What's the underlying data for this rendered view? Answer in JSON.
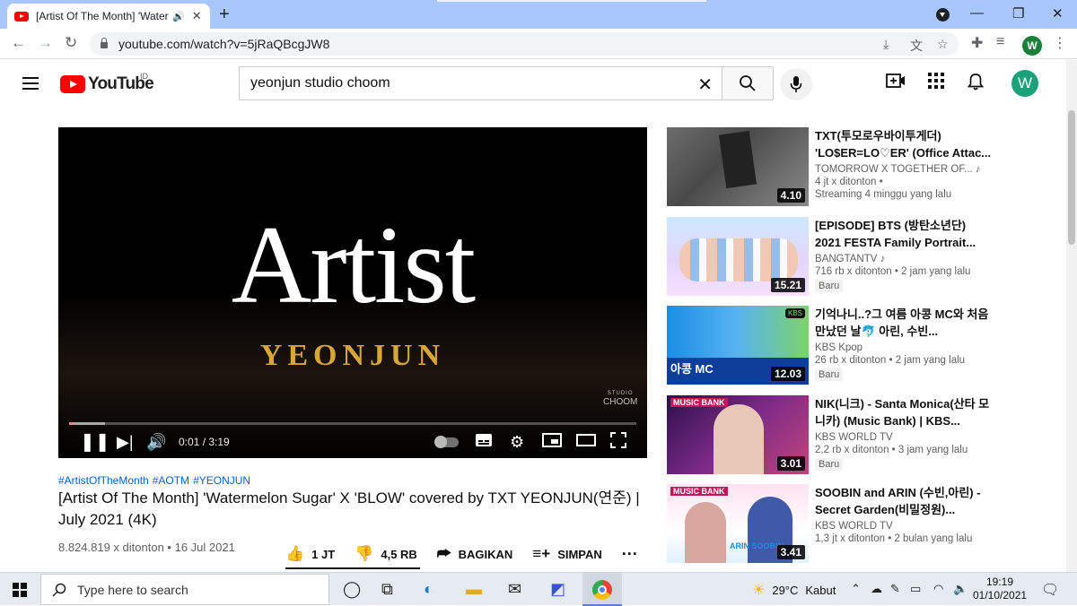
{
  "browser": {
    "tab_title": "[Artist Of The Month] 'Watermelon Sugar' X 'BLOW'",
    "tab_audio_icon": "speaker-icon",
    "url": "youtube.com/watch?v=5jRaQBcgJW8",
    "profile_initial": "W"
  },
  "masthead": {
    "logo_text": "YouTube",
    "country_code": "ID",
    "search_value": "yeonjun studio choom",
    "avatar_initial": "W"
  },
  "player": {
    "title_art": "Artist",
    "subtitle_art": "YEONJUN",
    "studio_mark_top": "STUDIO",
    "studio_mark": "CHOOM",
    "time_display": "0:01 / 3:19",
    "played_fraction": 0.005
  },
  "video": {
    "hashtags": [
      "#ArtistOfTheMonth",
      "#AOTM",
      "#YEONJUN"
    ],
    "title": "[Artist Of The Month] 'Watermelon Sugar' X 'BLOW' covered by TXT YEONJUN(연준) | July 2021 (4K)",
    "meta": "8.824.819 x ditonton • 16 Jul 2021",
    "like_label": "1 JT",
    "dislike_label": "4,5 RB",
    "share_label": "BAGIKAN",
    "save_label": "SIMPAN"
  },
  "recommendations": [
    {
      "title": "TXT(투모로우바이투게더) 'LO$ER=LO♡ER' (Office Attac...",
      "channel": "TOMORROW X TOGETHER OF...",
      "channel_badge": "♪",
      "stats_line1": "4 jt x ditonton •",
      "stats_line2": "Streaming 4 minggu yang lalu",
      "duration": "4.10",
      "badge": ""
    },
    {
      "title": "[EPISODE] BTS (방탄소년단) 2021 FESTA Family Portrait...",
      "channel": "BANGTANTV",
      "channel_badge": "♪",
      "stats_line1": "716 rb x ditonton • 2 jam yang lalu",
      "stats_line2": "",
      "duration": "15.21",
      "badge": "Baru"
    },
    {
      "title": "기억나니..?그 여름 아콩 MC와 처음 만났던 날🐬 아린, 수빈...",
      "channel": "KBS Kpop",
      "channel_badge": "",
      "stats_line1": "26 rb x ditonton • 2 jam yang lalu",
      "stats_line2": "",
      "duration": "12.03",
      "badge": "Baru",
      "thumb_text": "아콩 MC",
      "thumb_logo": "KBS"
    },
    {
      "title": "NIK(니크) - Santa Monica(산타 모니카) (Music Bank) | KBS...",
      "channel": "KBS WORLD TV",
      "channel_badge": "",
      "stats_line1": "2,2 rb x ditonton • 3 jam yang lalu",
      "stats_line2": "",
      "duration": "3.01",
      "badge": "Baru",
      "thumb_logo": "MUSIC BANK"
    },
    {
      "title": "SOOBIN and ARIN (수빈,아린) - Secret Garden(비밀정원)...",
      "channel": "KBS WORLD TV",
      "channel_badge": "",
      "stats_line1": "1,3 jt x ditonton • 2 bulan yang lalu",
      "stats_line2": "",
      "duration": "3.41",
      "badge": "",
      "thumb_logo": "MUSIC BANK",
      "thumb_caption": "ARIN SOOBIN"
    }
  ],
  "taskbar": {
    "search_placeholder": "Type here to search",
    "temperature": "29°C",
    "weather_desc": "Kabut",
    "time": "19:19",
    "date": "01/10/2021"
  },
  "colors": {
    "yt_red": "#ff0000",
    "link_blue": "#065fd4",
    "artist_gold": "#d8a537",
    "tab_strip": "#a8c7fa"
  }
}
